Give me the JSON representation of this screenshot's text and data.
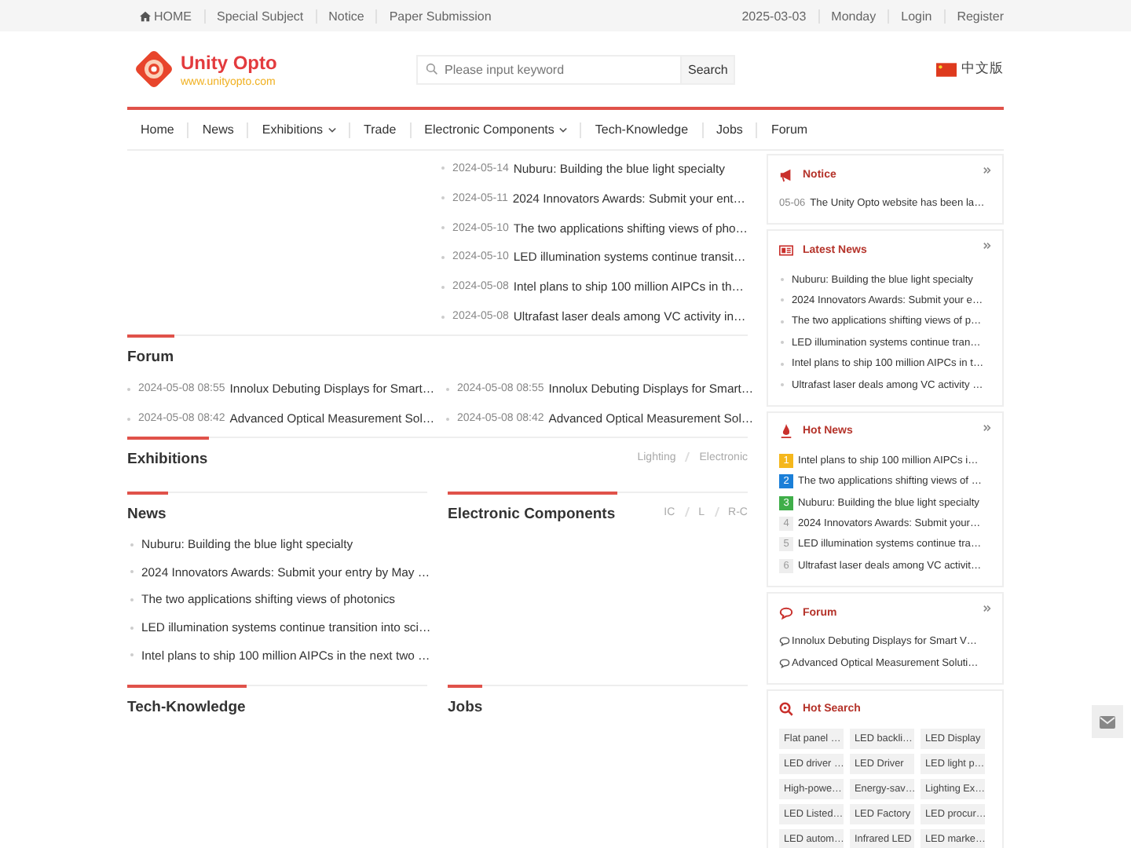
{
  "topbar": {
    "links": [
      "HOME",
      "Special Subject",
      "Notice",
      "Paper Submission"
    ],
    "date": "2025-03-03",
    "weekday": "Monday",
    "account": [
      "Login",
      "Register"
    ]
  },
  "header": {
    "brand": "Unity Opto",
    "url": "www.unityopto.com",
    "search": {
      "placeholder": "Please input keyword",
      "button": "Search"
    },
    "language": "中文版"
  },
  "nav": [
    {
      "label": "Home",
      "dropdown": false
    },
    {
      "label": "News",
      "dropdown": false
    },
    {
      "label": "Exhibitions",
      "dropdown": true
    },
    {
      "label": "Trade",
      "dropdown": false
    },
    {
      "label": "Electronic Components",
      "dropdown": true
    },
    {
      "label": "Tech-Knowledge",
      "dropdown": false
    },
    {
      "label": "Jobs",
      "dropdown": false
    },
    {
      "label": "Forum",
      "dropdown": false
    }
  ],
  "headlines": [
    {
      "date": "2024-05-14",
      "title": "Nuburu: Building the blue light specialty"
    },
    {
      "date": "2024-05-11",
      "title": "2024 Innovators Awards: Submit your ent…"
    },
    {
      "date": "2024-05-10",
      "title": "The two applications shifting views of pho…"
    },
    {
      "date": "2024-05-10",
      "title": "LED illumination systems continue transit…"
    },
    {
      "date": "2024-05-08",
      "title": "Intel plans to ship 100 million AIPCs in th…"
    },
    {
      "date": "2024-05-08",
      "title": "Ultrafast laser deals among VC activity in…"
    }
  ],
  "forum": {
    "title": "Forum",
    "items": [
      {
        "time": "2024-05-08 08:55",
        "title": "Innolux Debuting Displays for Smart…"
      },
      {
        "time": "2024-05-08 08:55",
        "title": "Innolux Debuting Displays for Smart…"
      },
      {
        "time": "2024-05-08 08:42",
        "title": "Advanced Optical Measurement Sol…"
      },
      {
        "time": "2024-05-08 08:42",
        "title": "Advanced Optical Measurement Sol…"
      }
    ]
  },
  "exhibitions": {
    "title": "Exhibitions",
    "tabs": [
      "Lighting",
      "Electronic"
    ]
  },
  "news": {
    "title": "News",
    "items": [
      "Nuburu: Building the blue light specialty",
      "2024 Innovators Awards: Submit your entry by May …",
      "The two applications shifting views of photonics",
      "LED illumination systems continue transition into sci…",
      "Intel plans to ship 100 million AIPCs in the next two …"
    ]
  },
  "electronic_components": {
    "title": "Electronic Components",
    "tabs": [
      "IC",
      "L",
      "R-C"
    ]
  },
  "tech_knowledge": {
    "title": "Tech-Knowledge"
  },
  "jobs": {
    "title": "Jobs"
  },
  "sidebar": {
    "notice": {
      "title": "Notice",
      "items": [
        {
          "date": "05-06",
          "title": "The Unity Opto website has been la…"
        }
      ]
    },
    "latest_news": {
      "title": "Latest News",
      "items": [
        "Nuburu: Building the blue light specialty",
        "2024 Innovators Awards: Submit your e…",
        "The two applications shifting views of p…",
        "LED illumination systems continue tran…",
        "Intel plans to ship 100 million AIPCs in t…",
        "Ultrafast laser deals among VC activity …"
      ]
    },
    "hot_news": {
      "title": "Hot News",
      "items": [
        {
          "rank": "1",
          "color": "#f5b71c",
          "title": "Intel plans to ship 100 million AIPCs i…"
        },
        {
          "rank": "2",
          "color": "#1b7fd8",
          "title": "The two applications shifting views of …"
        },
        {
          "rank": "3",
          "color": "#3fae49",
          "title": "Nuburu: Building the blue light specialty"
        },
        {
          "rank": "4",
          "color": "#eeeeee",
          "title": "2024 Innovators Awards: Submit your…"
        },
        {
          "rank": "5",
          "color": "#eeeeee",
          "title": "LED illumination systems continue tra…"
        },
        {
          "rank": "6",
          "color": "#eeeeee",
          "title": "Ultrafast laser deals among VC activit…"
        }
      ]
    },
    "forum": {
      "title": "Forum",
      "items": [
        "Innolux Debuting Displays for Smart V…",
        "Advanced Optical Measurement Soluti…"
      ]
    },
    "hot_search": {
      "title": "Hot Search",
      "tags": [
        "Flat panel …",
        "LED backli…",
        "LED Display",
        "LED driver …",
        "LED Driver",
        "LED light p…",
        "High-powe…",
        "Energy-sav…",
        "Lighting Ex…",
        "LED Listed…",
        "LED Factory",
        "LED procur…",
        "LED autom…",
        "Infrared LED",
        "LED marke…"
      ]
    }
  }
}
